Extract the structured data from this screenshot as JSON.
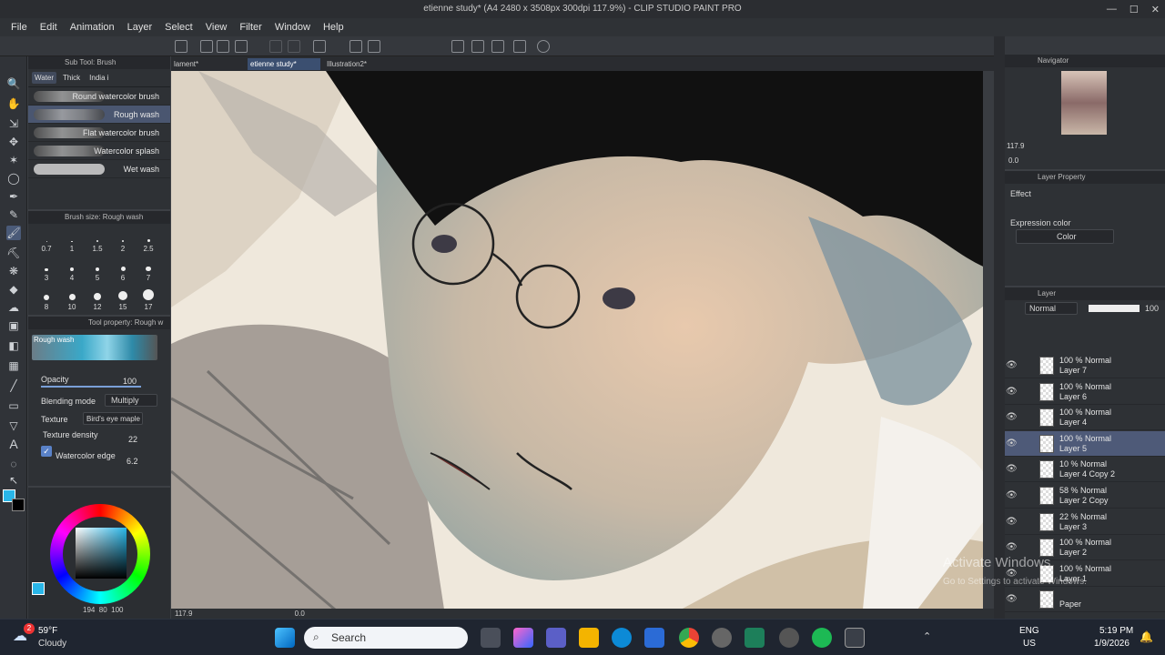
{
  "window": {
    "title": "etienne study* (A4 2480 x 3508px 300dpi 117.9%) - CLIP STUDIO PAINT PRO"
  },
  "menu": [
    "File",
    "Edit",
    "Animation",
    "Layer",
    "Select",
    "View",
    "Filter",
    "Window",
    "Help"
  ],
  "doc_tabs": [
    {
      "label": "lament*",
      "active": false
    },
    {
      "label": "etienne study*",
      "active": true
    },
    {
      "label": "Illustration2*",
      "active": false
    }
  ],
  "subtool": {
    "header": "Sub Tool: Brush",
    "tabs": [
      "Water",
      "Thick",
      "India i"
    ],
    "brushes": [
      {
        "label": "Round watercolor brush",
        "selected": false
      },
      {
        "label": "Rough wash",
        "selected": true
      },
      {
        "label": "Flat watercolor brush",
        "selected": false
      },
      {
        "label": "Watercolor splash",
        "selected": false
      },
      {
        "label": "Wet wash",
        "selected": false
      }
    ]
  },
  "brush_size": {
    "header": "Brush size: Rough wash",
    "sizes": [
      "0.7",
      "1",
      "1.5",
      "2",
      "2.5",
      "3",
      "4",
      "5",
      "6",
      "7",
      "8",
      "10",
      "12",
      "15",
      "17"
    ]
  },
  "tool_property": {
    "header": "Tool property: Rough w",
    "preview_label": "Rough wash",
    "opacity_label": "Opacity",
    "opacity_value": "100",
    "blending_label": "Blending mode",
    "blending_value": "Multiply",
    "texture_label": "Texture",
    "texture_value": "Bird's eye maple",
    "texture_density_label": "Texture density",
    "texture_density_value": "22",
    "watercolor_edge_label": "Watercolor edge",
    "watercolor_edge_value": "6.2"
  },
  "color": {
    "main": "#29b6e8",
    "sub": "#000000",
    "wheel_values": "194  80  100"
  },
  "canvas_status": {
    "zoom": "117.9",
    "pos": "0.0"
  },
  "navigator": {
    "header": "Navigator",
    "zoom": "117.9",
    "angle": "0.0"
  },
  "layer_property": {
    "header": "Layer Property",
    "effect_label": "Effect",
    "expression_label": "Expression color",
    "expression_value": "Color"
  },
  "layer_panel": {
    "header": "Layer",
    "blend_mode": "Normal",
    "opacity": "100",
    "layers": [
      {
        "mode": "100 % Normal",
        "name": "Layer 7",
        "selected": false
      },
      {
        "mode": "100 % Normal",
        "name": "Layer 6",
        "selected": false
      },
      {
        "mode": "100 % Normal",
        "name": "Layer 4",
        "selected": false
      },
      {
        "mode": "100 % Normal",
        "name": "Layer 5",
        "selected": true
      },
      {
        "mode": "10 % Normal",
        "name": "Layer 4 Copy 2",
        "selected": false
      },
      {
        "mode": "58 % Normal",
        "name": "Layer 2 Copy",
        "selected": false
      },
      {
        "mode": "22 % Normal",
        "name": "Layer 3",
        "selected": false
      },
      {
        "mode": "100 % Normal",
        "name": "Layer 2",
        "selected": false
      },
      {
        "mode": "100 % Normal",
        "name": "Layer 1",
        "selected": false
      },
      {
        "mode": "",
        "name": "Paper",
        "selected": false
      }
    ]
  },
  "watermark": {
    "line1": "Activate Windows",
    "line2": "Go to Settings to activate Windows."
  },
  "taskbar": {
    "weather_temp": "59°F",
    "weather_desc": "Cloudy",
    "weather_badge": "2",
    "search_placeholder": "Search",
    "lang_line1": "ENG",
    "lang_line2": "US",
    "time": "5:19 PM",
    "date": "1/9/2026"
  }
}
